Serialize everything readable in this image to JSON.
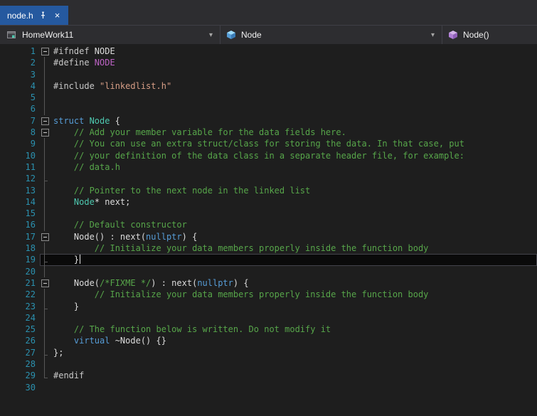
{
  "tab": {
    "title": "node.h",
    "close_label": "×"
  },
  "navbar": {
    "project_label": "HomeWork11",
    "type_label": "Node",
    "member_label": "Node()",
    "chevron": "▾"
  },
  "colors": {
    "pp": "#c8c8c8",
    "macro": "#bd63c5",
    "str": "#d69d85",
    "kw": "#569cd6",
    "type": "#4ec9b0",
    "cmt": "#57a64a",
    "plain": "#dcdcdc",
    "line_number": "#2b91af",
    "editor_bg": "#1e1e1e",
    "chrome_bg": "#2d2d30",
    "active_tab_bg": "#25599f",
    "current_line_bg": "#0a0a0a"
  },
  "editor": {
    "cursor": {
      "line": 19
    },
    "lines": [
      {
        "n": 1,
        "fold": "box",
        "seg": [
          {
            "t": "#ifndef ",
            "c": "pp"
          },
          {
            "t": "NODE",
            "c": "plain"
          }
        ]
      },
      {
        "n": 2,
        "fold": "line",
        "seg": [
          {
            "t": "#define ",
            "c": "pp"
          },
          {
            "t": "NODE",
            "c": "macro"
          }
        ]
      },
      {
        "n": 3,
        "fold": "line",
        "seg": []
      },
      {
        "n": 4,
        "fold": "line",
        "seg": [
          {
            "t": "#include ",
            "c": "pp"
          },
          {
            "t": "\"linkedlist.h\"",
            "c": "str"
          }
        ]
      },
      {
        "n": 5,
        "fold": "line",
        "seg": []
      },
      {
        "n": 6,
        "fold": "line",
        "seg": []
      },
      {
        "n": 7,
        "fold": "box",
        "seg": [
          {
            "t": "struct ",
            "c": "kw"
          },
          {
            "t": "Node",
            "c": "type"
          },
          {
            "t": " {",
            "c": "plain"
          }
        ]
      },
      {
        "n": 8,
        "fold": "box",
        "seg": [
          {
            "t": "    ",
            "c": "plain"
          },
          {
            "t": "// Add your member variable for the data fields here.",
            "c": "cmt"
          }
        ]
      },
      {
        "n": 9,
        "fold": "line",
        "seg": [
          {
            "t": "    ",
            "c": "plain"
          },
          {
            "t": "// You can use an extra struct/class for storing the data. In that case, put",
            "c": "cmt"
          }
        ]
      },
      {
        "n": 10,
        "fold": "line",
        "seg": [
          {
            "t": "    ",
            "c": "plain"
          },
          {
            "t": "// your definition of the data class in a separate header file, for example:",
            "c": "cmt"
          }
        ]
      },
      {
        "n": 11,
        "fold": "line",
        "seg": [
          {
            "t": "    ",
            "c": "plain"
          },
          {
            "t": "// data.h",
            "c": "cmt"
          }
        ]
      },
      {
        "n": 12,
        "fold": "endc",
        "seg": []
      },
      {
        "n": 13,
        "fold": "line",
        "seg": [
          {
            "t": "    ",
            "c": "plain"
          },
          {
            "t": "// Pointer to the next node in the linked list",
            "c": "cmt"
          }
        ]
      },
      {
        "n": 14,
        "fold": "line",
        "seg": [
          {
            "t": "    ",
            "c": "plain"
          },
          {
            "t": "Node",
            "c": "type"
          },
          {
            "t": "* next;",
            "c": "plain"
          }
        ]
      },
      {
        "n": 15,
        "fold": "line",
        "seg": []
      },
      {
        "n": 16,
        "fold": "line",
        "seg": [
          {
            "t": "    ",
            "c": "plain"
          },
          {
            "t": "// Default constructor",
            "c": "cmt"
          }
        ]
      },
      {
        "n": 17,
        "fold": "box",
        "seg": [
          {
            "t": "    Node() : next(",
            "c": "plain"
          },
          {
            "t": "nullptr",
            "c": "kw"
          },
          {
            "t": ") {",
            "c": "plain"
          }
        ]
      },
      {
        "n": 18,
        "fold": "line",
        "seg": [
          {
            "t": "        ",
            "c": "plain"
          },
          {
            "t": "// Initialize your data members properly inside the function body",
            "c": "cmt"
          }
        ]
      },
      {
        "n": 19,
        "fold": "endc",
        "seg": [
          {
            "t": "    }",
            "c": "plain"
          }
        ]
      },
      {
        "n": 20,
        "fold": "line",
        "seg": []
      },
      {
        "n": 21,
        "fold": "box",
        "seg": [
          {
            "t": "    Node(",
            "c": "plain"
          },
          {
            "t": "/*FIXME */",
            "c": "cmt"
          },
          {
            "t": ") : next(",
            "c": "plain"
          },
          {
            "t": "nullptr",
            "c": "kw"
          },
          {
            "t": ") {",
            "c": "plain"
          }
        ]
      },
      {
        "n": 22,
        "fold": "line",
        "seg": [
          {
            "t": "        ",
            "c": "plain"
          },
          {
            "t": "// Initialize your data members properly inside the function body",
            "c": "cmt"
          }
        ]
      },
      {
        "n": 23,
        "fold": "endc",
        "seg": [
          {
            "t": "    }",
            "c": "plain"
          }
        ]
      },
      {
        "n": 24,
        "fold": "line",
        "seg": []
      },
      {
        "n": 25,
        "fold": "line",
        "seg": [
          {
            "t": "    ",
            "c": "plain"
          },
          {
            "t": "// The function below is written. Do not modify it",
            "c": "cmt"
          }
        ]
      },
      {
        "n": 26,
        "fold": "line",
        "seg": [
          {
            "t": "    ",
            "c": "plain"
          },
          {
            "t": "virtual",
            "c": "kw"
          },
          {
            "t": " ~Node() {}",
            "c": "plain"
          }
        ]
      },
      {
        "n": 27,
        "fold": "endc",
        "seg": [
          {
            "t": "};",
            "c": "plain"
          }
        ]
      },
      {
        "n": 28,
        "fold": "line",
        "seg": []
      },
      {
        "n": 29,
        "fold": "end",
        "seg": [
          {
            "t": "#endif",
            "c": "pp"
          }
        ]
      },
      {
        "n": 30,
        "fold": "none",
        "seg": []
      }
    ]
  }
}
